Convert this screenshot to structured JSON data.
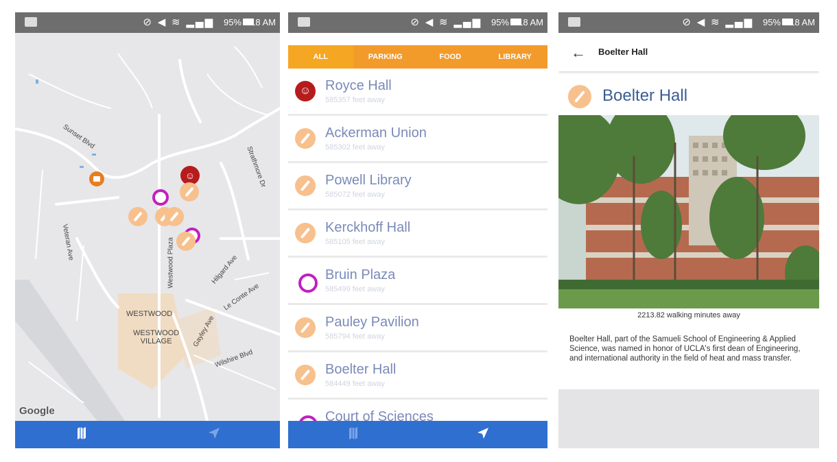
{
  "status_bar": {
    "icons": "⊘ ◀ ≋ ▂▄▆",
    "battery": "95%",
    "time": "3:18 AM"
  },
  "map_screen": {
    "google_logo": "Google",
    "labels": {
      "westwood": "WESTWOOD",
      "westwood_village": "WESTWOOD\nVILLAGE",
      "sunset_blvd": "Sunset Blvd",
      "westwood_plaza": "Westwood Plaza",
      "gayley_ave": "Gayley Ave",
      "hilgard": "Hilgard Ave",
      "veteran": "Veteran Ave",
      "wilshire": "Wilshire Blvd",
      "le_conte": "Le Conte Ave",
      "strathmore": "Strathmore Dr"
    }
  },
  "list_screen": {
    "tabs": [
      "ALL",
      "PARKING",
      "FOOD",
      "LIBRARY"
    ],
    "items": [
      {
        "name": "Royce Hall",
        "distance": "585357 feet away",
        "icon": "theater-icon"
      },
      {
        "name": "Ackerman Union",
        "distance": "585302 feet away",
        "icon": "pencil-icon"
      },
      {
        "name": "Powell Library",
        "distance": "585072 feet away",
        "icon": "pencil-icon"
      },
      {
        "name": "Kerckhoff Hall",
        "distance": "585105 feet away",
        "icon": "pencil-icon"
      },
      {
        "name": "Bruin Plaza",
        "distance": "585499 feet away",
        "icon": "camera-icon"
      },
      {
        "name": "Pauley Pavilion",
        "distance": "585794 feet away",
        "icon": "pencil-icon"
      },
      {
        "name": "Boelter Hall",
        "distance": "584449 feet away",
        "icon": "pencil-icon"
      },
      {
        "name": "Court of Sciences",
        "distance": "",
        "icon": "camera-icon"
      }
    ]
  },
  "detail_screen": {
    "appbar_title": "Boelter Hall",
    "heading": "Boelter Hall",
    "walking": "2213.82 walking minutes away",
    "description": "Boelter Hall, part of the Samueli School of Engineering & Applied Science, was named in honor of UCLA's first dean of Engineering, and international authority in the field of heat and mass transfer."
  },
  "colors": {
    "tab_orange": "#f5a623",
    "nav_blue": "#2f6fd0",
    "pin_peach": "#f7c08d",
    "royce_red": "#b71c1c",
    "camera_purple": "#c020c0",
    "title_blue": "#3b5d96"
  }
}
